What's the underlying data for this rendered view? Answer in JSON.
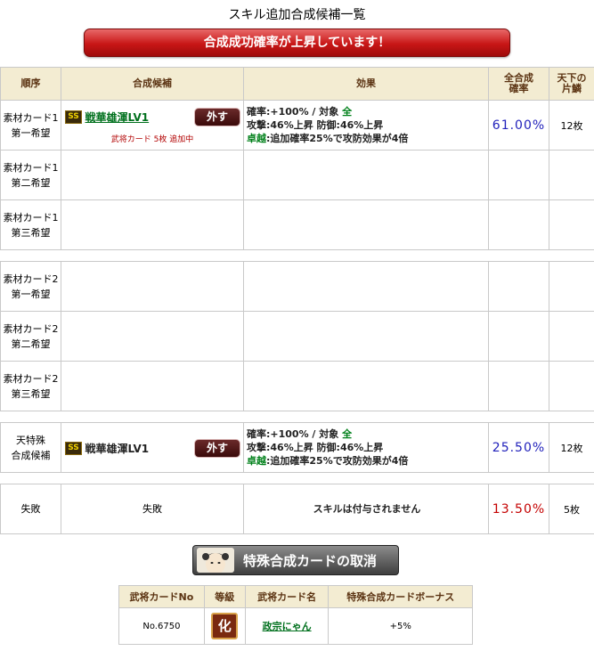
{
  "page_title": "スキル追加合成候補一覧",
  "banner": "合成成功確率が上昇しています！",
  "headers": {
    "order": "順序",
    "candidate": "合成候補",
    "effect": "効果",
    "rate": "全合成確率",
    "sheets": "天下の片鱗"
  },
  "slots": [
    {
      "line1": "素材カード1",
      "line2": "第一希望"
    },
    {
      "line1": "素材カード1",
      "line2": "第二希望"
    },
    {
      "line1": "素材カード1",
      "line2": "第三希望"
    },
    {
      "line1": "素材カード2",
      "line2": "第一希望"
    },
    {
      "line1": "素材カード2",
      "line2": "第二希望"
    },
    {
      "line1": "素材カード2",
      "line2": "第三希望"
    }
  ],
  "candidate1": {
    "rarity": "SS",
    "skill": "戦華雄渾LV1",
    "remove": "外す",
    "note": "武将カード 5枚 追加中",
    "effect_line1_a": "確率:+100% / 対象 ",
    "effect_line1_b": "全",
    "effect_line2": "攻撃:46%上昇 防御:46%上昇",
    "effect_line3_a": "卓越",
    "effect_line3_b": ":追加確率25%で攻防効果が4倍",
    "rate": "61.00%",
    "sheets": "12枚"
  },
  "special": {
    "line1": "天特殊",
    "line2": "合成候補",
    "rarity": "SS",
    "skill": "戦華雄渾LV1",
    "remove": "外す",
    "effect_line1_a": "確率:+100% / 対象 ",
    "effect_line1_b": "全",
    "effect_line2": "攻撃:46%上昇 防御:46%上昇",
    "effect_line3_a": "卓越",
    "effect_line3_b": ":追加確率25%で攻防効果が4倍",
    "rate": "25.50%",
    "sheets": "12枚"
  },
  "fail": {
    "order": "失敗",
    "candidate": "失敗",
    "effect": "スキルは付与されません",
    "rate": "13.50%",
    "sheets": "5枚"
  },
  "cancel_button": "特殊合成カードの取消",
  "bottom_table": {
    "headers": [
      "武将カードNo",
      "等級",
      "武将カード名",
      "特殊合成カードボーナス"
    ],
    "row": {
      "no": "No.6750",
      "grade": "化",
      "name": "政宗にゃん",
      "bonus": "+5%"
    }
  },
  "colors": {
    "banner": "#c81616",
    "rate": "#2222bb",
    "fail_rate": "#c40000",
    "link": "#00701d"
  }
}
